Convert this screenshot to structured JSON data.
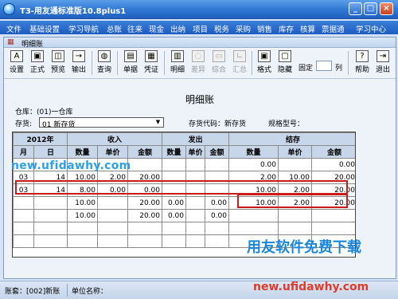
{
  "window": {
    "title": "T3-用友通标准版10.8plus1",
    "min": "_",
    "max": "□",
    "close": "×"
  },
  "menu": [
    "文件",
    "基础设置",
    "学习导航",
    "总账",
    "往来",
    "现金",
    "出纳",
    "项目",
    "税务",
    "采购",
    "销售",
    "库存",
    "核算",
    "票据通",
    "学习中心"
  ],
  "child": {
    "title": "明细账"
  },
  "toolbar": {
    "buttons": [
      {
        "label": "设置",
        "icon": "A"
      },
      {
        "label": "正式",
        "icon": "▣"
      },
      {
        "label": "预览",
        "icon": "◫"
      },
      {
        "label": "输出",
        "icon": "→"
      },
      {
        "label": "查询",
        "icon": "◍"
      },
      {
        "label": "单据",
        "icon": "▤"
      },
      {
        "label": "凭证",
        "icon": "▦"
      },
      {
        "label": "明细",
        "icon": "▥"
      },
      {
        "label": "差异",
        "icon": "◌"
      },
      {
        "label": "综合",
        "icon": "▭"
      },
      {
        "label": "汇总",
        "icon": "∟"
      },
      {
        "label": "格式",
        "icon": "▣"
      },
      {
        "label": "隐藏",
        "icon": "▢"
      },
      {
        "label": "帮助",
        "icon": "?"
      },
      {
        "label": "退出",
        "icon": "⇥"
      }
    ],
    "fixed_label": "固定",
    "fixed_value": "",
    "col_label": "列"
  },
  "page": {
    "title": "明细账",
    "warehouse": "仓库：(01)一仓库",
    "inventory_label": "存货:",
    "inventory_value": "01 新存货",
    "inventory_code": "存货代码：新存货",
    "model": "规格型号："
  },
  "table": {
    "year": "2012年",
    "month": "月",
    "day": "日",
    "income": "收入",
    "issue": "发出",
    "balance": "结存",
    "qty": "数量",
    "price": "单价",
    "amount": "金额",
    "rows": [
      [
        "",
        "",
        "",
        "",
        "",
        "",
        "",
        "",
        "0.00",
        "",
        "0.00"
      ],
      [
        "03",
        "14",
        "10.00",
        "2.00",
        "20.00",
        "",
        "",
        "",
        "2.00",
        "10.00",
        "20.00"
      ],
      [
        "03",
        "14",
        "8.00",
        "0.00",
        "0.00",
        "",
        "",
        "",
        "10.00",
        "2.00",
        "20.00"
      ],
      [
        "",
        "",
        "10.00",
        "",
        "20.00",
        "0.00",
        "",
        "0.00",
        "10.00",
        "2.00",
        "20.00"
      ],
      [
        "",
        "",
        "10.00",
        "",
        "20.00",
        "0.00",
        "",
        "0.00",
        "",
        "",
        ""
      ]
    ]
  },
  "status": {
    "account": "账套：[002]新账",
    "unit": "单位名称："
  },
  "watermark": {
    "url": "new.ufidawhy.com",
    "brand": "用友软件免费下载",
    "url2": "new.ufidawhy.com"
  }
}
